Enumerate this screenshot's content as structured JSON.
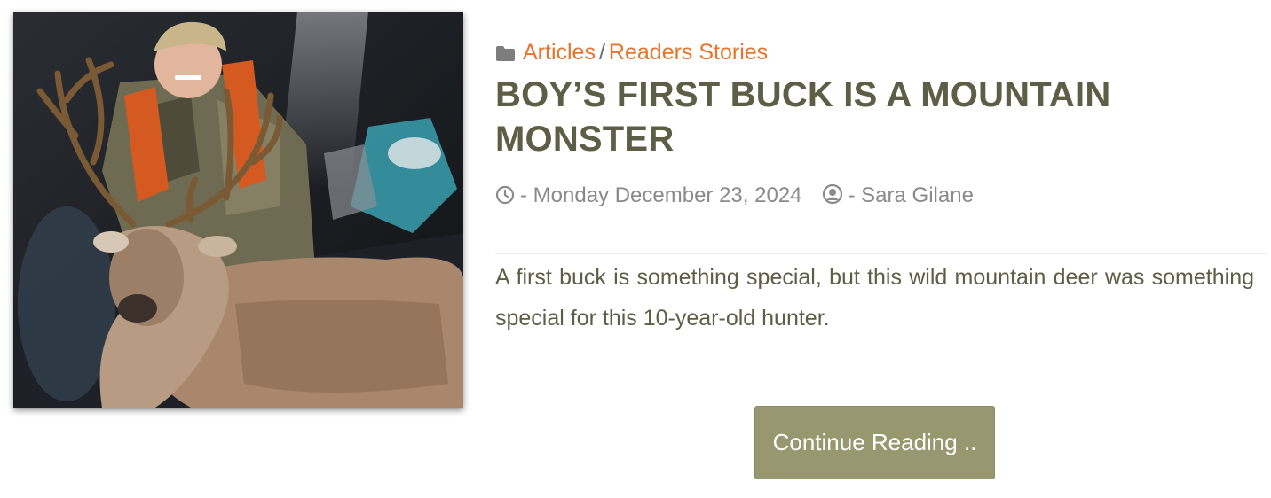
{
  "post": {
    "categories": [
      {
        "label": "Articles"
      },
      {
        "label": "Readers Stories"
      }
    ],
    "category_separator": "/",
    "title": "BOY’S FIRST BUCK IS A MOUNTAIN MONSTER",
    "date": "- Monday December 23, 2024",
    "author": "- Sara Gilane",
    "excerpt": "A first buck is something special, but this wild mountain deer was something special for this 10-year-old hunter.",
    "button_label": "Continue Reading ..",
    "icons": {
      "category": "folder-icon",
      "date": "clock-icon",
      "author": "user-circle-icon"
    }
  },
  "colors": {
    "accent": "#e8742b",
    "title": "#5c5e45",
    "meta": "#8a8a8a",
    "button": "#979770"
  }
}
